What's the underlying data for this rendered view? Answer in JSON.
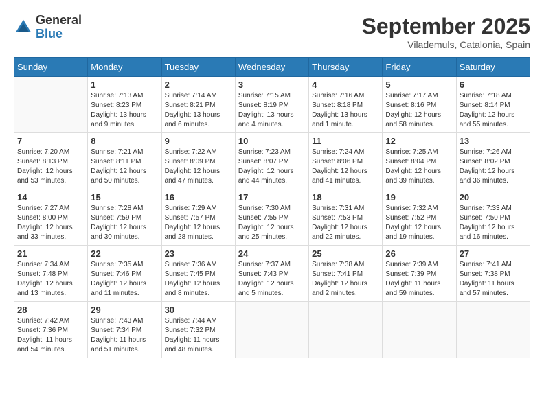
{
  "header": {
    "logo_general": "General",
    "logo_blue": "Blue",
    "month_title": "September 2025",
    "location": "Vilademuls, Catalonia, Spain"
  },
  "weekdays": [
    "Sunday",
    "Monday",
    "Tuesday",
    "Wednesday",
    "Thursday",
    "Friday",
    "Saturday"
  ],
  "weeks": [
    [
      {
        "day": "",
        "info": ""
      },
      {
        "day": "1",
        "info": "Sunrise: 7:13 AM\nSunset: 8:23 PM\nDaylight: 13 hours\nand 9 minutes."
      },
      {
        "day": "2",
        "info": "Sunrise: 7:14 AM\nSunset: 8:21 PM\nDaylight: 13 hours\nand 6 minutes."
      },
      {
        "day": "3",
        "info": "Sunrise: 7:15 AM\nSunset: 8:19 PM\nDaylight: 13 hours\nand 4 minutes."
      },
      {
        "day": "4",
        "info": "Sunrise: 7:16 AM\nSunset: 8:18 PM\nDaylight: 13 hours\nand 1 minute."
      },
      {
        "day": "5",
        "info": "Sunrise: 7:17 AM\nSunset: 8:16 PM\nDaylight: 12 hours\nand 58 minutes."
      },
      {
        "day": "6",
        "info": "Sunrise: 7:18 AM\nSunset: 8:14 PM\nDaylight: 12 hours\nand 55 minutes."
      }
    ],
    [
      {
        "day": "7",
        "info": "Sunrise: 7:20 AM\nSunset: 8:13 PM\nDaylight: 12 hours\nand 53 minutes."
      },
      {
        "day": "8",
        "info": "Sunrise: 7:21 AM\nSunset: 8:11 PM\nDaylight: 12 hours\nand 50 minutes."
      },
      {
        "day": "9",
        "info": "Sunrise: 7:22 AM\nSunset: 8:09 PM\nDaylight: 12 hours\nand 47 minutes."
      },
      {
        "day": "10",
        "info": "Sunrise: 7:23 AM\nSunset: 8:07 PM\nDaylight: 12 hours\nand 44 minutes."
      },
      {
        "day": "11",
        "info": "Sunrise: 7:24 AM\nSunset: 8:06 PM\nDaylight: 12 hours\nand 41 minutes."
      },
      {
        "day": "12",
        "info": "Sunrise: 7:25 AM\nSunset: 8:04 PM\nDaylight: 12 hours\nand 39 minutes."
      },
      {
        "day": "13",
        "info": "Sunrise: 7:26 AM\nSunset: 8:02 PM\nDaylight: 12 hours\nand 36 minutes."
      }
    ],
    [
      {
        "day": "14",
        "info": "Sunrise: 7:27 AM\nSunset: 8:00 PM\nDaylight: 12 hours\nand 33 minutes."
      },
      {
        "day": "15",
        "info": "Sunrise: 7:28 AM\nSunset: 7:59 PM\nDaylight: 12 hours\nand 30 minutes."
      },
      {
        "day": "16",
        "info": "Sunrise: 7:29 AM\nSunset: 7:57 PM\nDaylight: 12 hours\nand 28 minutes."
      },
      {
        "day": "17",
        "info": "Sunrise: 7:30 AM\nSunset: 7:55 PM\nDaylight: 12 hours\nand 25 minutes."
      },
      {
        "day": "18",
        "info": "Sunrise: 7:31 AM\nSunset: 7:53 PM\nDaylight: 12 hours\nand 22 minutes."
      },
      {
        "day": "19",
        "info": "Sunrise: 7:32 AM\nSunset: 7:52 PM\nDaylight: 12 hours\nand 19 minutes."
      },
      {
        "day": "20",
        "info": "Sunrise: 7:33 AM\nSunset: 7:50 PM\nDaylight: 12 hours\nand 16 minutes."
      }
    ],
    [
      {
        "day": "21",
        "info": "Sunrise: 7:34 AM\nSunset: 7:48 PM\nDaylight: 12 hours\nand 13 minutes."
      },
      {
        "day": "22",
        "info": "Sunrise: 7:35 AM\nSunset: 7:46 PM\nDaylight: 12 hours\nand 11 minutes."
      },
      {
        "day": "23",
        "info": "Sunrise: 7:36 AM\nSunset: 7:45 PM\nDaylight: 12 hours\nand 8 minutes."
      },
      {
        "day": "24",
        "info": "Sunrise: 7:37 AM\nSunset: 7:43 PM\nDaylight: 12 hours\nand 5 minutes."
      },
      {
        "day": "25",
        "info": "Sunrise: 7:38 AM\nSunset: 7:41 PM\nDaylight: 12 hours\nand 2 minutes."
      },
      {
        "day": "26",
        "info": "Sunrise: 7:39 AM\nSunset: 7:39 PM\nDaylight: 11 hours\nand 59 minutes."
      },
      {
        "day": "27",
        "info": "Sunrise: 7:41 AM\nSunset: 7:38 PM\nDaylight: 11 hours\nand 57 minutes."
      }
    ],
    [
      {
        "day": "28",
        "info": "Sunrise: 7:42 AM\nSunset: 7:36 PM\nDaylight: 11 hours\nand 54 minutes."
      },
      {
        "day": "29",
        "info": "Sunrise: 7:43 AM\nSunset: 7:34 PM\nDaylight: 11 hours\nand 51 minutes."
      },
      {
        "day": "30",
        "info": "Sunrise: 7:44 AM\nSunset: 7:32 PM\nDaylight: 11 hours\nand 48 minutes."
      },
      {
        "day": "",
        "info": ""
      },
      {
        "day": "",
        "info": ""
      },
      {
        "day": "",
        "info": ""
      },
      {
        "day": "",
        "info": ""
      }
    ]
  ]
}
